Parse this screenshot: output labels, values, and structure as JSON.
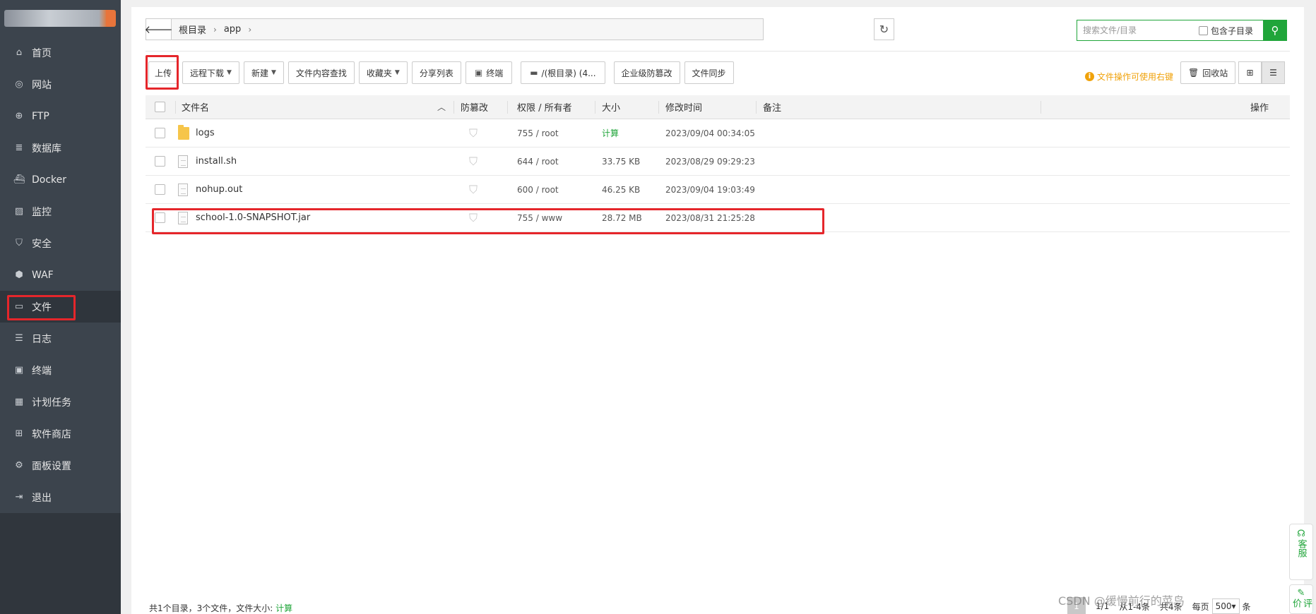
{
  "sidebar": {
    "items": [
      {
        "label": "首页",
        "icon": "home-icon",
        "glyph": "⌂"
      },
      {
        "label": "网站",
        "icon": "globe-icon",
        "glyph": "◎"
      },
      {
        "label": "FTP",
        "icon": "ftp-icon",
        "glyph": "⊕"
      },
      {
        "label": "数据库",
        "icon": "database-icon",
        "glyph": "≣"
      },
      {
        "label": "Docker",
        "icon": "docker-icon",
        "glyph": "⛴"
      },
      {
        "label": "监控",
        "icon": "monitor-icon",
        "glyph": "▨"
      },
      {
        "label": "安全",
        "icon": "shield-icon",
        "glyph": "⛉"
      },
      {
        "label": "WAF",
        "icon": "waf-icon",
        "glyph": "⬢"
      },
      {
        "label": "文件",
        "icon": "folder-icon",
        "glyph": "▭"
      },
      {
        "label": "日志",
        "icon": "log-icon",
        "glyph": "☰"
      },
      {
        "label": "终端",
        "icon": "terminal-icon",
        "glyph": "▣"
      },
      {
        "label": "计划任务",
        "icon": "calendar-icon",
        "glyph": "▦"
      },
      {
        "label": "软件商店",
        "icon": "apps-icon",
        "glyph": "⊞"
      },
      {
        "label": "面板设置",
        "icon": "gear-icon",
        "glyph": "⚙"
      },
      {
        "label": "退出",
        "icon": "logout-icon",
        "glyph": "⇥"
      }
    ]
  },
  "path": {
    "crumbs": [
      "根目录",
      "app"
    ]
  },
  "search": {
    "placeholder": "搜索文件/目录",
    "include_sub": "包含子目录"
  },
  "toolbar": {
    "upload": "上传",
    "remote_download": "远程下载",
    "new": "新建",
    "content_search": "文件内容查找",
    "favorites": "收藏夹",
    "share_list": "分享列表",
    "terminal": "终端",
    "disk": "/(根目录) (4...",
    "tamper": "企业级防篡改",
    "sync": "文件同步",
    "tip": "文件操作可使用右键",
    "recycle": "回收站"
  },
  "table": {
    "headers": {
      "name": "文件名",
      "tamper": "防篡改",
      "perm": "权限 / 所有者",
      "size": "大小",
      "mtime": "修改时间",
      "note": "备注",
      "ops": "操作"
    },
    "rows": [
      {
        "name": "logs",
        "type": "folder",
        "perm": "755 / root",
        "size": "计算",
        "mtime": "2023/09/04 00:34:05"
      },
      {
        "name": "install.sh",
        "type": "file",
        "perm": "644 / root",
        "size": "33.75 KB",
        "mtime": "2023/08/29 09:29:23"
      },
      {
        "name": "nohup.out",
        "type": "file",
        "perm": "600 / root",
        "size": "46.25 KB",
        "mtime": "2023/09/04 19:03:49"
      },
      {
        "name": "school-1.0-SNAPSHOT.jar",
        "type": "file",
        "perm": "755 / www",
        "size": "28.72 MB",
        "mtime": "2023/08/31 21:25:28"
      }
    ]
  },
  "footer": {
    "summary": "共1个目录，3个文件，文件大小:",
    "calc": "计算",
    "page_current": "1",
    "page_total": "1/1",
    "range": "从1-4条",
    "total": "共4条",
    "per_page_label": "每页",
    "per_page": "500",
    "unit": "条"
  },
  "watermark": "CSDN @缓慢前行的菜鸟",
  "float": {
    "service": "客服",
    "feedback": "评价"
  }
}
